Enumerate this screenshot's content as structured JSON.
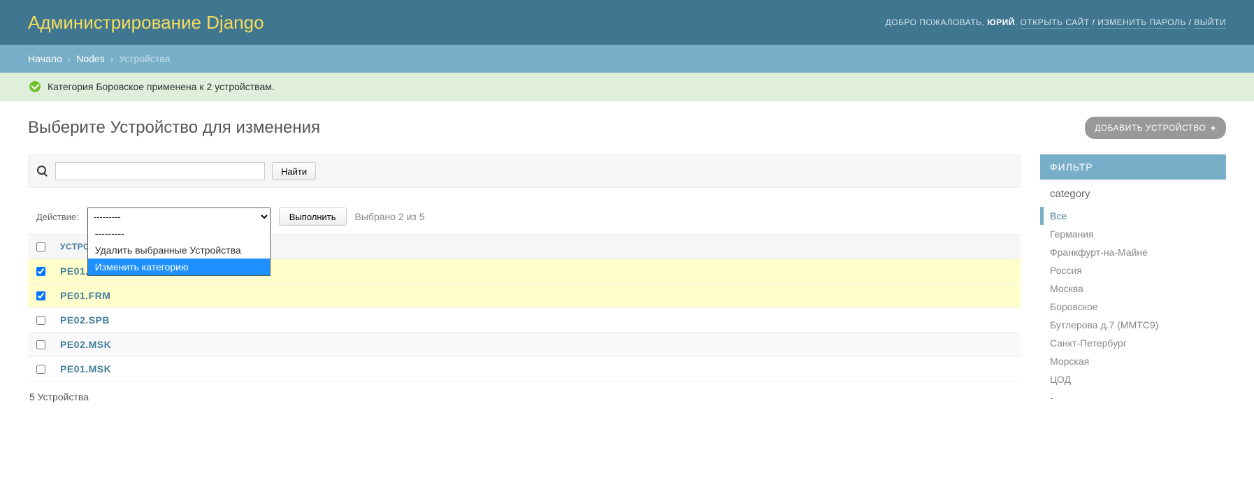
{
  "header": {
    "site_title": "Администрирование Django",
    "welcome": "ДОБРО ПОЖАЛОВАТЬ,",
    "username": "ЮРИЙ",
    "view_site": "ОТКРЫТЬ САЙТ",
    "change_password": "ИЗМЕНИТЬ ПАРОЛЬ",
    "logout": "ВЫЙТИ"
  },
  "breadcrumbs": {
    "home": "Начало",
    "app": "Nodes",
    "model": "Устройства",
    "sep": "›"
  },
  "message": "Категория Боровское применена к 2 устройствам.",
  "page_title": "Выберите Устройство для изменения",
  "add_button": "ДОБАВИТЬ УСТРОЙСТВО",
  "search": {
    "value": "",
    "button": "Найти"
  },
  "actions": {
    "label": "Действие:",
    "selected_display": "---------",
    "options": {
      "blank": "---------",
      "delete": "Удалить выбранные Устройства",
      "change_category": "Изменить категорию"
    },
    "go": "Выполнить",
    "counter": "Выбрано 2 из 5"
  },
  "table": {
    "header": "УСТРОЙСТВО",
    "rows": [
      {
        "name": "pe01.spb",
        "checked": true
      },
      {
        "name": "pe01.frm",
        "checked": true
      },
      {
        "name": "pe02.spb",
        "checked": false
      },
      {
        "name": "pe02.msk",
        "checked": false
      },
      {
        "name": "pe01.msk",
        "checked": false
      }
    ]
  },
  "paginator": "5 Устройства",
  "filter": {
    "title": "ФИЛЬТР",
    "group_label": "category",
    "items": [
      {
        "label": "Все",
        "active": true
      },
      {
        "label": "Германия",
        "active": false
      },
      {
        "label": "Франкфурт-на-Майне",
        "active": false
      },
      {
        "label": "Россия",
        "active": false
      },
      {
        "label": "Москва",
        "active": false
      },
      {
        "label": "Боровское",
        "active": false
      },
      {
        "label": "Бутлерова д.7 (ММТС9)",
        "active": false
      },
      {
        "label": "Санкт-Петербург",
        "active": false
      },
      {
        "label": "Морская",
        "active": false
      },
      {
        "label": "ЦОД",
        "active": false
      },
      {
        "label": "-",
        "active": false
      }
    ]
  }
}
